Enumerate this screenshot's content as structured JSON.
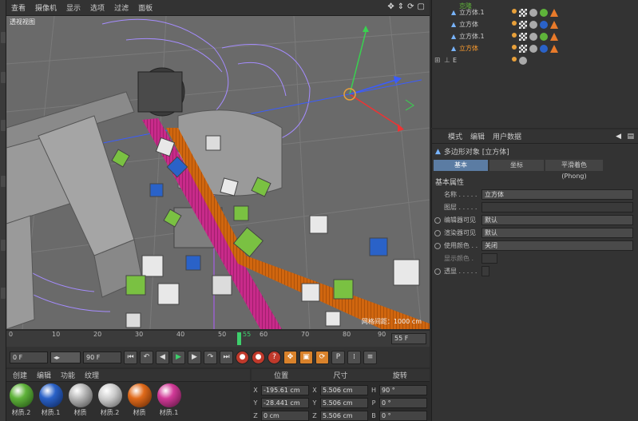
{
  "viewport": {
    "menu": [
      "查看",
      "摄像机",
      "显示",
      "选项",
      "过滤",
      "面板"
    ],
    "nav_icons": [
      "move-view-icon",
      "zoom-view-icon",
      "rotate-view-icon",
      "maximize-icon"
    ],
    "label": "透视视图",
    "grid_label": "网格间距：1000 cm"
  },
  "timeline": {
    "ticks": [
      "0",
      "10",
      "20",
      "30",
      "40",
      "50",
      "60",
      "70",
      "80",
      "90"
    ],
    "marker_label": "55",
    "current_frame": "55 F"
  },
  "transport": {
    "start_field": "0 F",
    "end_field": "90 F",
    "buttons": [
      "go-start-icon",
      "prev-key-icon",
      "prev-frame-icon",
      "play-icon",
      "next-frame-icon",
      "next-key-icon",
      "go-end-icon"
    ],
    "record_buttons": [
      "record-icon",
      "autokey-icon",
      "key-info-icon"
    ],
    "key_buttons": [
      "move-key-icon",
      "scale-key-icon",
      "rotate-key-icon",
      "param-key-icon",
      "pla-key-icon",
      "menu-icon"
    ]
  },
  "materials": {
    "menu": [
      "创建",
      "编辑",
      "功能",
      "纹理"
    ],
    "items": [
      {
        "label": "材质.2",
        "color": "#5fb33a"
      },
      {
        "label": "材质.1",
        "color": "#2a62c8"
      },
      {
        "label": "材质",
        "color": "#b0b0b0"
      },
      {
        "label": "材质.2",
        "color": "#c9c9c9"
      },
      {
        "label": "材质",
        "color": "#e06a1a"
      },
      {
        "label": "材质.1",
        "color": "#d23a98"
      }
    ]
  },
  "coordinates": {
    "headers": [
      "位置",
      "尺寸",
      "旋转"
    ],
    "rows": [
      {
        "axis": "X",
        "pos": "-195.61 cm",
        "size_axis": "X",
        "size": "5.506 cm",
        "rot_axis": "H",
        "rot": "90 °"
      },
      {
        "axis": "Y",
        "pos": "-28.441 cm",
        "size_axis": "Y",
        "size": "5.506 cm",
        "rot_axis": "P",
        "rot": "0 °"
      },
      {
        "axis": "Z",
        "pos": "0 cm",
        "size_axis": "Z",
        "size": "5.506 cm",
        "rot_axis": "B",
        "rot": "0 °"
      }
    ]
  },
  "object_manager": {
    "top_item": "克隆",
    "items": [
      {
        "name": "立方体.1",
        "selected": false,
        "colors": [
          "#5fb33a",
          "#2a62c8"
        ]
      },
      {
        "name": "立方体",
        "selected": false,
        "colors": [
          "#5fb33a",
          "#2a62c8"
        ]
      },
      {
        "name": "立方体.1",
        "selected": false,
        "colors": [
          "#5fb33a",
          "#2a62c8"
        ]
      },
      {
        "name": "立方体",
        "selected": true,
        "colors": [
          "#5fb33a",
          "#2a62c8"
        ]
      }
    ],
    "last_item": "E"
  },
  "attribute_manager": {
    "menu": [
      "模式",
      "编辑",
      "用户数据"
    ],
    "title": "多边形对象 [立方体]",
    "tabs": [
      "基本",
      "坐标",
      "平滑着色(Phong)"
    ],
    "section": "基本属性",
    "props": [
      {
        "label": "名称 . . . . .",
        "value": "立方体"
      },
      {
        "label": "图层 . . . . .",
        "value": ""
      },
      {
        "label": "编辑器可见",
        "value": "默认"
      },
      {
        "label": "渲染器可见",
        "value": "默认"
      },
      {
        "label": "使用颜色 . .",
        "value": "关闭"
      },
      {
        "label": "显示颜色 .",
        "value": ""
      },
      {
        "label": "透显 . . . . .",
        "value": ""
      }
    ]
  }
}
